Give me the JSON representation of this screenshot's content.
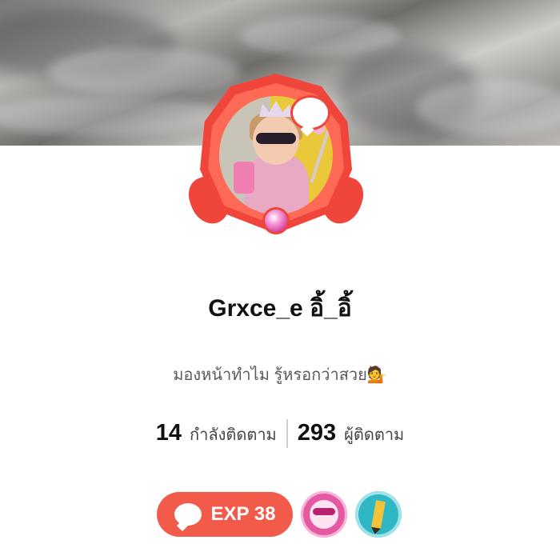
{
  "profile": {
    "username": "Grxce_e อิ้_อิ้",
    "bio": "มองหน้าทำไม รู้หรอกว่าสวย💁"
  },
  "stats": {
    "following_count": "14",
    "following_label": "กำลังติดตาม",
    "followers_count": "293",
    "followers_label": "ผู้ติดตาม"
  },
  "badges": {
    "exp_label": "EXP 38",
    "items": [
      "chat-bubble-icon",
      "sunglasses-face-icon",
      "pencil-icon"
    ]
  },
  "colors": {
    "accent": "#f25b49",
    "frame": "#f0453a",
    "pencil_badge": "#2fb7c4",
    "glasses_badge": "#e35aa3"
  }
}
